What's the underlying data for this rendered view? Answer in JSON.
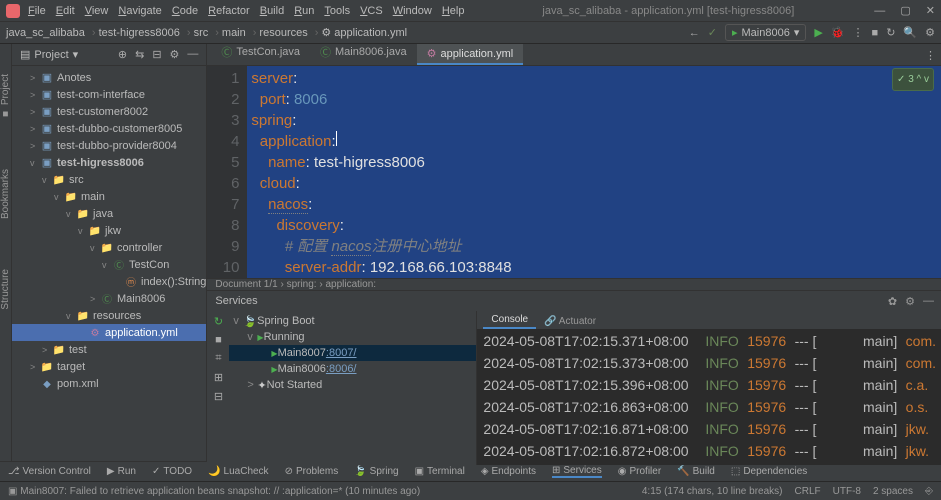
{
  "menu": [
    "File",
    "Edit",
    "View",
    "Navigate",
    "Code",
    "Refactor",
    "Build",
    "Run",
    "Tools",
    "VCS",
    "Window",
    "Help"
  ],
  "title": "java_sc_alibaba - application.yml [test-higress8006]",
  "breadcrumbs": [
    "java_sc_alibaba",
    "test-higress8006",
    "src",
    "main",
    "resources",
    "application.yml"
  ],
  "runconfig": "Main8006",
  "project_label": "Project",
  "tree": [
    {
      "d": 1,
      "exp": ">",
      "ico": "mod",
      "t": "Anotes"
    },
    {
      "d": 1,
      "exp": ">",
      "ico": "mod",
      "t": "test-com-interface"
    },
    {
      "d": 1,
      "exp": ">",
      "ico": "mod",
      "t": "test-customer8002"
    },
    {
      "d": 1,
      "exp": ">",
      "ico": "mod",
      "t": "test-dubbo-customer8005"
    },
    {
      "d": 1,
      "exp": ">",
      "ico": "mod",
      "t": "test-dubbo-provider8004"
    },
    {
      "d": 1,
      "exp": "v",
      "ico": "mod",
      "t": "test-higress8006",
      "b": true
    },
    {
      "d": 2,
      "exp": "v",
      "ico": "folder",
      "t": "src"
    },
    {
      "d": 3,
      "exp": "v",
      "ico": "folder",
      "t": "main"
    },
    {
      "d": 4,
      "exp": "v",
      "ico": "folder",
      "t": "java"
    },
    {
      "d": 5,
      "exp": "v",
      "ico": "folder",
      "t": "jkw"
    },
    {
      "d": 6,
      "exp": "v",
      "ico": "folder",
      "t": "controller"
    },
    {
      "d": 7,
      "exp": "v",
      "ico": "class",
      "t": "TestCon"
    },
    {
      "d": 8,
      "exp": "",
      "ico": "meth",
      "t": "index():String"
    },
    {
      "d": 6,
      "exp": ">",
      "ico": "class",
      "t": "Main8006"
    },
    {
      "d": 4,
      "exp": "v",
      "ico": "folder",
      "t": "resources"
    },
    {
      "d": 5,
      "exp": "",
      "ico": "yml",
      "t": "application.yml",
      "sel": true
    },
    {
      "d": 2,
      "exp": ">",
      "ico": "folder",
      "t": "test"
    },
    {
      "d": 1,
      "exp": ">",
      "ico": "folder",
      "t": "target"
    },
    {
      "d": 1,
      "exp": "",
      "ico": "xml",
      "t": "pom.xml"
    }
  ],
  "tabs": [
    {
      "label": "TestCon.java",
      "ico": "Ⓒ",
      "active": false
    },
    {
      "label": "Main8006.java",
      "ico": "Ⓒ",
      "active": false
    },
    {
      "label": "application.yml",
      "ico": "⚙",
      "active": true
    }
  ],
  "check": "✓ 3 ^ v",
  "code_lines": [
    1,
    2,
    3,
    4,
    5,
    6,
    7,
    8,
    9,
    10
  ],
  "code_crumb": "Document 1/1  ›  spring:  ›  application:",
  "chart_data": {
    "type": "yaml",
    "content": {
      "server": {
        "port": 8006
      },
      "spring": {
        "application": {
          "name": "test-higress8006"
        },
        "cloud": {
          "nacos": {
            "discovery": {
              "_comment": "配置 nacos注册中心地址",
              "server-addr": "192.168.66.103:8848"
            }
          }
        }
      }
    }
  },
  "services_label": "Services",
  "svc_tree": [
    {
      "d": 0,
      "exp": "v",
      "ico": "🍃",
      "t": "Spring Boot"
    },
    {
      "d": 1,
      "exp": "v",
      "ico": "▶",
      "t": "Running",
      "cls": "run"
    },
    {
      "d": 2,
      "exp": "",
      "ico": "▶",
      "t": "Main8007",
      "port": ":8007/",
      "sel": true
    },
    {
      "d": 2,
      "exp": "",
      "ico": "▶",
      "t": "Main8006",
      "port": ":8006/"
    },
    {
      "d": 1,
      "exp": ">",
      "ico": "✦",
      "t": "Not Started"
    }
  ],
  "svc_tabs": [
    "Console",
    "Actuator"
  ],
  "console": [
    {
      "ts": "2024-05-08T17:02:15.371+08:00",
      "lvl": "INFO",
      "pid": "15976",
      "thr": "main",
      "pkg": "com."
    },
    {
      "ts": "2024-05-08T17:02:15.373+08:00",
      "lvl": "INFO",
      "pid": "15976",
      "thr": "main",
      "pkg": "com."
    },
    {
      "ts": "2024-05-08T17:02:15.396+08:00",
      "lvl": "INFO",
      "pid": "15976",
      "thr": "main",
      "pkg": "c.a."
    },
    {
      "ts": "2024-05-08T17:02:16.863+08:00",
      "lvl": "INFO",
      "pid": "15976",
      "thr": "main",
      "pkg": "o.s."
    },
    {
      "ts": "2024-05-08T17:02:16.871+08:00",
      "lvl": "INFO",
      "pid": "15976",
      "thr": "main",
      "pkg": "jkw."
    },
    {
      "ts": "2024-05-08T17:02:16.872+08:00",
      "lvl": "INFO",
      "pid": "15976",
      "thr": "main",
      "pkg": "jkw."
    }
  ],
  "bottombar": [
    "Version Control",
    "Run",
    "TODO",
    "LuaCheck",
    "Problems",
    "Spring",
    "Terminal",
    "Endpoints",
    "Services",
    "Profiler",
    "Build",
    "Dependencies"
  ],
  "status_msg": "Main8007: Failed to retrieve application beans snapshot: // :application=* (10 minutes ago)",
  "status_right": [
    "4:15 (174 chars, 10 line breaks)",
    "CRLF",
    "UTF-8",
    "2 spaces",
    "⎆"
  ]
}
